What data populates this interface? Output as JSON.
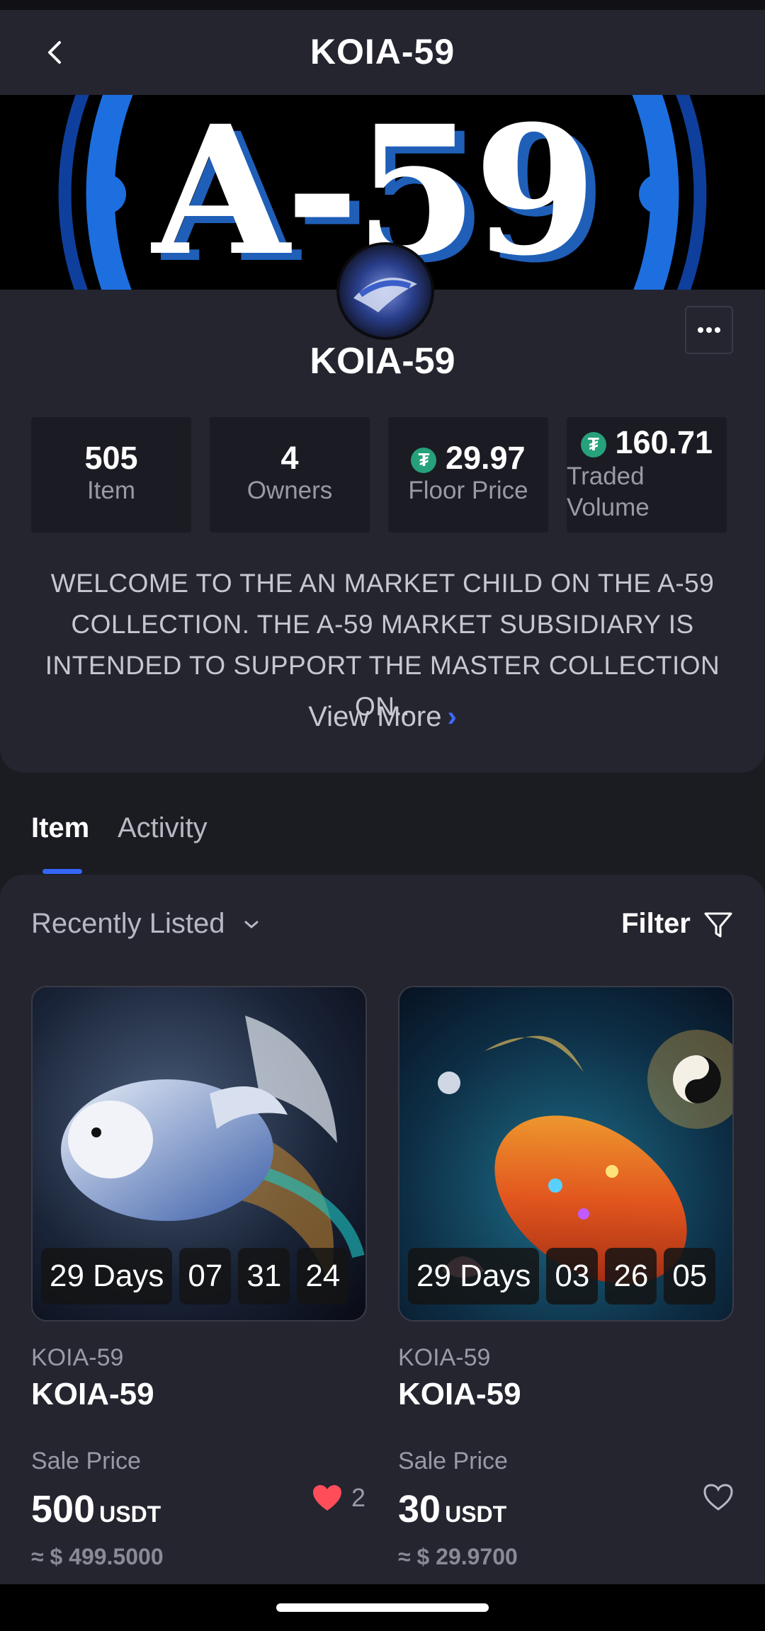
{
  "header": {
    "title": "KOIA-59"
  },
  "banner": {
    "text": "A-59"
  },
  "collection": {
    "name": "KOIA-59",
    "stats": [
      {
        "value": "505",
        "label": "Item"
      },
      {
        "value": "4",
        "label": "Owners"
      },
      {
        "value": "29.97",
        "label": "Floor Price"
      },
      {
        "value": "160.71",
        "label": "Traded Volume"
      }
    ],
    "description": "WELCOME TO THE AN MARKET CHILD ON THE A-59 COLLECTION. THE A-59 MARKET SUBSIDIARY IS INTENDED TO SUPPORT THE MASTER COLLECTION ON..",
    "view_more": "View More"
  },
  "tabs": [
    {
      "label": "Item"
    },
    {
      "label": "Activity"
    }
  ],
  "listing": {
    "sort_label": "Recently Listed",
    "filter_label": "Filter",
    "items": [
      {
        "timer": {
          "days": "29 Days",
          "h": "07",
          "m": "31",
          "s": "24"
        },
        "collection": "KOIA-59",
        "name": "KOIA-59",
        "sale_label": "Sale Price",
        "price": "500",
        "unit": "USDT",
        "usd": "≈ $ 499.5000",
        "likes": "2",
        "liked": true
      },
      {
        "timer": {
          "days": "29 Days",
          "h": "03",
          "m": "26",
          "s": "05"
        },
        "collection": "KOIA-59",
        "name": "KOIA-59",
        "sale_label": "Sale Price",
        "price": "30",
        "unit": "USDT",
        "usd": "≈ $ 29.9700",
        "likes": "",
        "liked": false
      }
    ]
  },
  "colors": {
    "accent": "#3467f5",
    "like": "#ff4d5a",
    "tether": "#26a17b"
  }
}
